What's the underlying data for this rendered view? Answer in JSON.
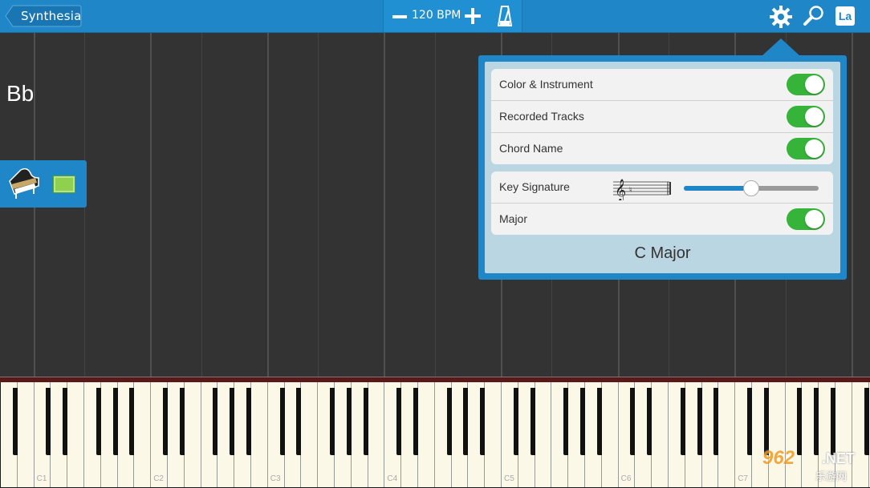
{
  "header": {
    "back_label": "Synthesia",
    "bpm_label": "120 BPM",
    "label_button": "La"
  },
  "notefield": {
    "key_label": "Bb",
    "track_color": "#8fd14f"
  },
  "popup": {
    "group1": [
      {
        "label": "Color & Instrument",
        "on": true
      },
      {
        "label": "Recorded Tracks",
        "on": true
      },
      {
        "label": "Chord Name",
        "on": true
      }
    ],
    "key_signature_label": "Key Signature",
    "key_signature_slider": 0.5,
    "major_label": "Major",
    "major_on": true,
    "scale_name": "C Major"
  },
  "keyboard": {
    "octave_labels": [
      "C1",
      "C2",
      "C3",
      "C4",
      "C5",
      "C6",
      "C7"
    ]
  },
  "watermark": {
    "number": "962",
    "suffix": ".NET",
    "subtitle": "乐游网"
  },
  "colors": {
    "accent": "#1f86c8",
    "toggle_on": "#36b43a"
  }
}
